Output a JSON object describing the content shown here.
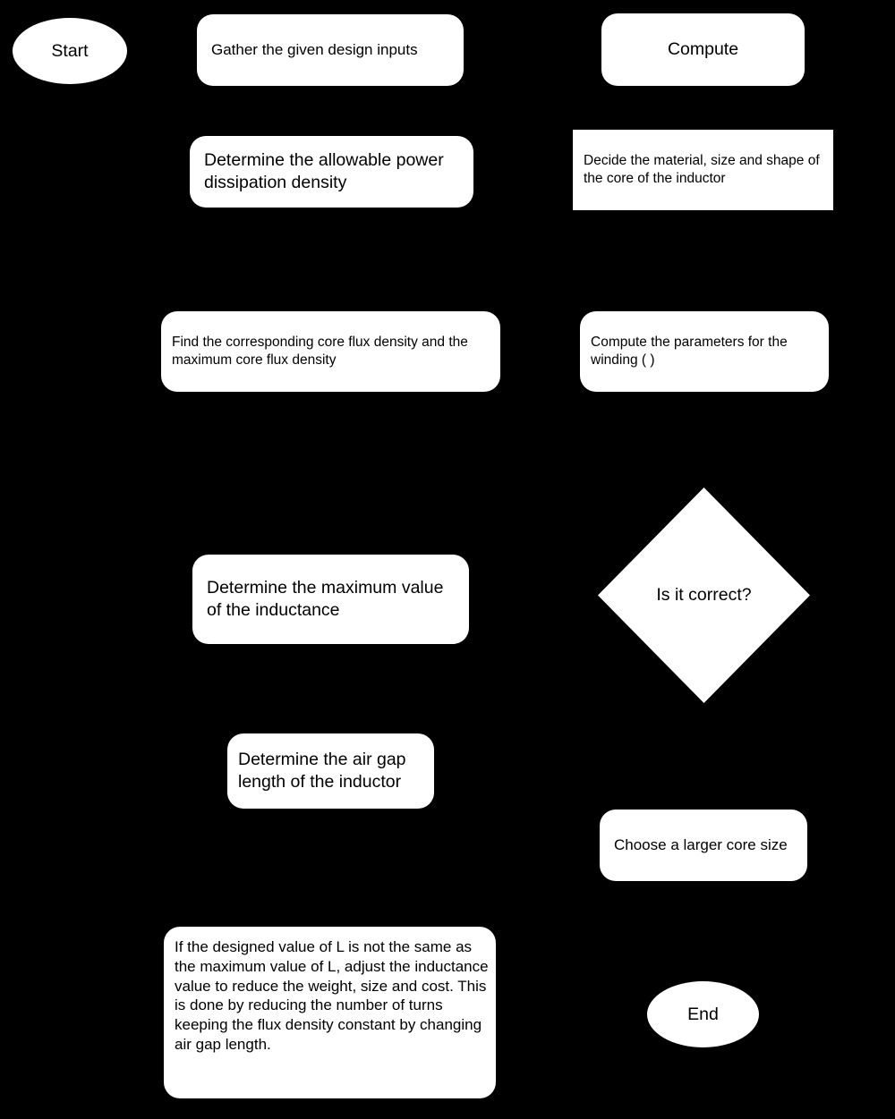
{
  "diagram": {
    "title": "Inductor design procedure flowchart",
    "background_color": "#000000",
    "node_fill_color": "#ffffff",
    "node_text_color": "#000000"
  },
  "nodes": {
    "start": {
      "label": "Start",
      "shape": "ellipse"
    },
    "gather_inputs": {
      "label": "Gather the given design inputs",
      "shape": "rounded-rectangle"
    },
    "compute": {
      "label": "Compute",
      "shape": "rounded-rectangle"
    },
    "allowable_power": {
      "label": "Determine the allowable power dissipation density",
      "shape": "rounded-rectangle"
    },
    "decide_core": {
      "label": "Decide the material, size and shape of the core of the inductor",
      "shape": "rectangle"
    },
    "find_flux": {
      "label": "Find the corresponding core flux density and the maximum core flux density",
      "shape": "rounded-rectangle"
    },
    "winding_params": {
      "label": "Compute the parameters for the winding ( )",
      "shape": "rounded-rectangle"
    },
    "max_inductance": {
      "label": "Determine the maximum value of the inductance",
      "shape": "rounded-rectangle"
    },
    "is_correct": {
      "label": "Is it correct?",
      "shape": "diamond"
    },
    "air_gap": {
      "label": "Determine the air gap length of the inductor",
      "shape": "rounded-rectangle"
    },
    "larger_core": {
      "label": "Choose a larger core size",
      "shape": "rounded-rectangle"
    },
    "adjust_inductance": {
      "label": "If the designed value of L is not the same as the maximum value of L, adjust the inductance value to reduce the weight, size and cost. This is done by reducing the number of turns keeping the flux density constant by changing air gap length.",
      "shape": "rounded-rectangle"
    },
    "end": {
      "label": "End",
      "shape": "ellipse"
    }
  }
}
